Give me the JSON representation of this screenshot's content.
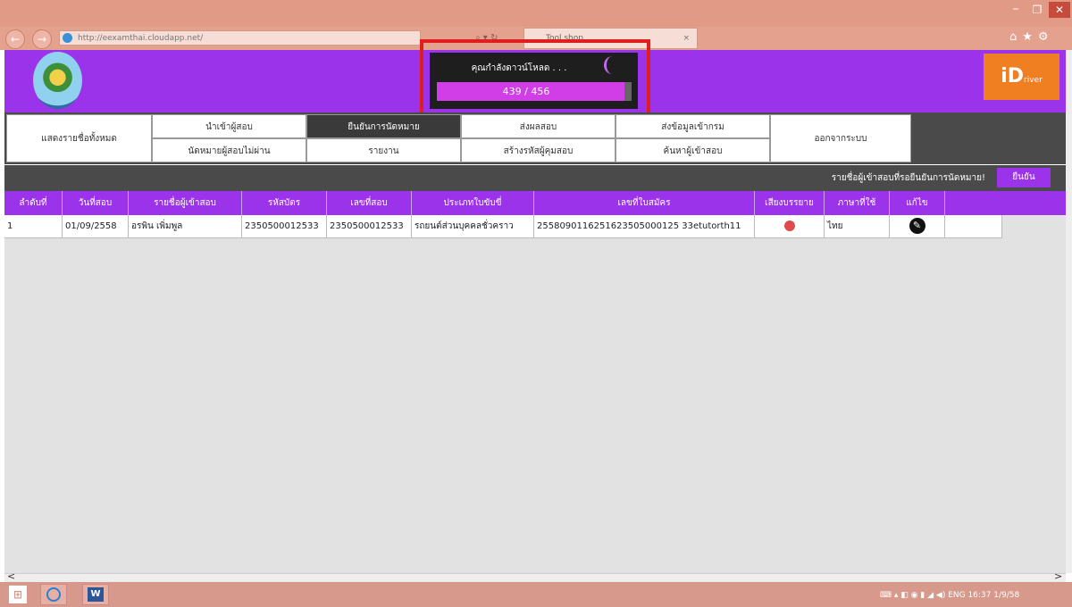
{
  "browser": {
    "url": "http://eexamthai.cloudapp.net/",
    "tab_title": "Tool shop",
    "tab_close": "×",
    "back": "←",
    "forward": "→",
    "addr_controls": "⌕ ▾ ↻",
    "window_min": "–",
    "window_max": "❐",
    "window_close": "✕",
    "right_icons": "⌂★⚙"
  },
  "header": {
    "brand_main": "iD",
    "brand_sub": "river"
  },
  "loader": {
    "message": "คุณกำลังดาวน์โหลด . . .",
    "progress_text": "439 / 456",
    "progress_fraction": 0.963
  },
  "menu": {
    "show_all": "แสดงรายชื่อทั้งหมด",
    "row1": [
      "นำเข้าผู้สอบ",
      "ยืนยันการนัดหมาย",
      "ส่งผลสอบ",
      "ส่งข้อมูลเข้ากรม"
    ],
    "row2": [
      "นัดหมายผู้สอบไม่ผ่าน",
      "รายงาน",
      "สร้างรหัสผู้คุมสอบ",
      "ค้นหาผู้เข้าสอบ"
    ],
    "logout": "ออกจากระบบ"
  },
  "toolbar": {
    "pending_label": "รายชื่อผู้เข้าสอบที่รอยืนยันการนัดหมาย!",
    "confirm_button": "ยืนยัน"
  },
  "table": {
    "headers": [
      "ลำดับที่",
      "วันที่สอบ",
      "รายชื่อผู้เข้าสอบ",
      "รหัสบัตร",
      "เลขที่สอบ",
      "ประเภทใบขับขี่",
      "เลขที่ใบสมัคร",
      "เสียงบรรยาย",
      "ภาษาที่ใช้",
      "แก้ไข"
    ],
    "rows": [
      [
        "1",
        "01/09/2558",
        "อรพิน เพิ่มพูล",
        "2350500012533",
        "2350500012533",
        "รถยนต์ส่วนบุคคลชั่วคราว",
        "2558090116251623505000125 33etutorth11",
        "",
        "ไทย",
        ""
      ]
    ]
  },
  "taskbar": {
    "start": "⊞",
    "word": "W",
    "tray": "⌨ ▴ ◧ ◉ ▮ ◢ ◀) ENG 16:37 1/9/58"
  }
}
